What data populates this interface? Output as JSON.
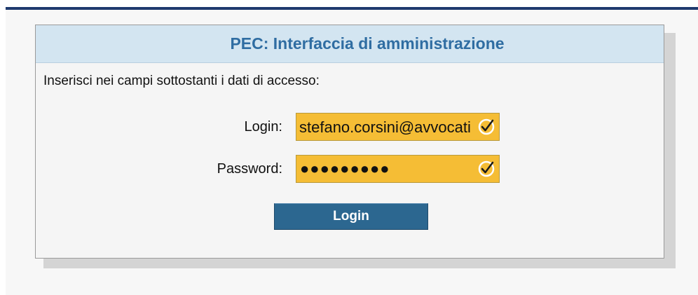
{
  "header": {
    "title": "PEC: Interfaccia di amministrazione"
  },
  "form": {
    "instructions": "Inserisci nei campi sottostanti i dati di accesso:",
    "login_label": "Login:",
    "login_value": "stefano.corsini@avvocati",
    "password_label": "Password:",
    "password_masked": "●●●●●●●●●",
    "field_autofill_color": "#f5bd35",
    "field_icon": "checkmark-circle-icon",
    "submit_label": "Login"
  },
  "colors": {
    "top_bar": "#1e3a6e",
    "header_bg": "#d3e5f1",
    "header_text": "#2f6da2",
    "button_bg": "#2c6790"
  }
}
